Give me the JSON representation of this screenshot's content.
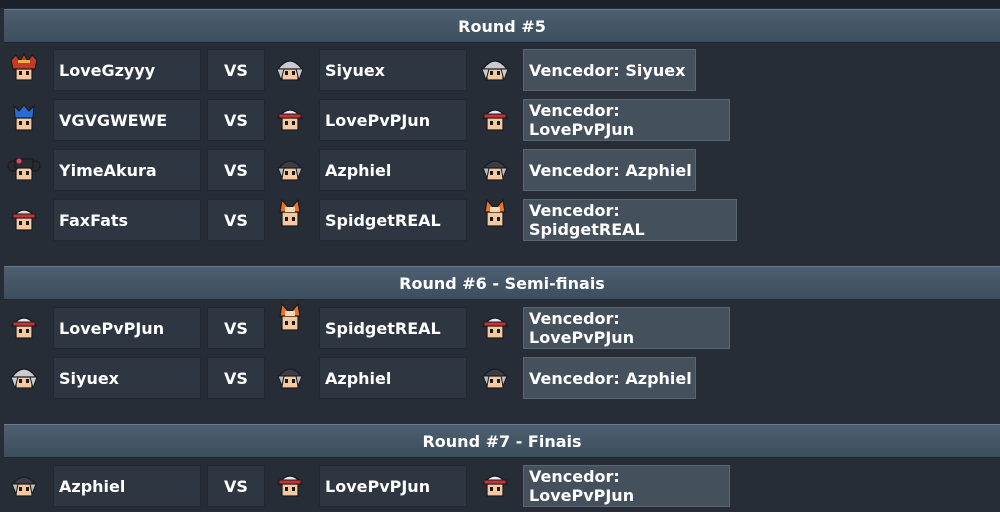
{
  "rounds": [
    {
      "title": "Round #5",
      "matches": [
        {
          "p1": "LoveGzyyy",
          "p1_icon": "red-demon-avatar-icon",
          "vs": "VS",
          "p2": "Siyuex",
          "p2_icon": "silver-hair-avatar-icon",
          "winner_icon": "silver-hair-avatar-icon",
          "winner": "Vencedor: Siyuex"
        },
        {
          "p1": "VGVGWEWE",
          "p1_icon": "blue-hair-avatar-icon",
          "vs": "VS",
          "p2": "LovePvPJun",
          "p2_icon": "red-cap-avatar-icon",
          "winner_icon": "red-cap-avatar-icon",
          "winner": "Vencedor: LovePvPJun"
        },
        {
          "p1": "YimeAkura",
          "p1_icon": "black-pigtails-avatar-icon",
          "vs": "VS",
          "p2": "Azphiel",
          "p2_icon": "gray-hood-avatar-icon",
          "winner_icon": "gray-hood-avatar-icon",
          "winner": "Vencedor: Azphiel"
        },
        {
          "p1": "FaxFats",
          "p1_icon": "red-hat-avatar-icon",
          "vs": "VS",
          "p2": "SpidgetREAL",
          "p2_icon": "orange-cat-avatar-icon",
          "winner_icon": "orange-cat-avatar-icon",
          "winner": "Vencedor: SpidgetREAL"
        }
      ]
    },
    {
      "title": "Round #6 - Semi-finais",
      "matches": [
        {
          "p1": "LovePvPJun",
          "p1_icon": "red-cap-avatar-icon",
          "vs": "VS",
          "p2": "SpidgetREAL",
          "p2_icon": "orange-cat-avatar-icon",
          "winner_icon": "red-cap-avatar-icon",
          "winner": "Vencedor: LovePvPJun"
        },
        {
          "p1": "Siyuex",
          "p1_icon": "silver-hair-avatar-icon",
          "vs": "VS",
          "p2": "Azphiel",
          "p2_icon": "gray-hood-avatar-icon",
          "winner_icon": "gray-hood-avatar-icon",
          "winner": "Vencedor: Azphiel"
        }
      ]
    },
    {
      "title": "Round #7 - Finais",
      "matches": [
        {
          "p1": "Azphiel",
          "p1_icon": "gray-hood-avatar-icon",
          "vs": "VS",
          "p2": "LovePvPJun",
          "p2_icon": "red-cap-avatar-icon",
          "winner_icon": "red-cap-avatar-icon",
          "winner": "Vencedor: LovePvPJun"
        }
      ]
    }
  ],
  "avatar_colors": {
    "red-demon-avatar-icon": {
      "hair": "#c23a2a",
      "accent": "#f0b040"
    },
    "blue-hair-avatar-icon": {
      "hair": "#2a6cd6",
      "accent": "#78b4ff"
    },
    "black-pigtails-avatar-icon": {
      "hair": "#2a2a32",
      "accent": "#e04a5a"
    },
    "red-hat-avatar-icon": {
      "hair": "#d8dce0",
      "accent": "#c8323a"
    },
    "silver-hair-avatar-icon": {
      "hair": "#c8ccd2",
      "accent": "#8a9098"
    },
    "red-cap-avatar-icon": {
      "hair": "#c8323a",
      "accent": "#e8e8ec"
    },
    "gray-hood-avatar-icon": {
      "hair": "#3a3e46",
      "accent": "#b8bcc4"
    },
    "orange-cat-avatar-icon": {
      "hair": "#e8742a",
      "accent": "#f8d8b0"
    }
  }
}
